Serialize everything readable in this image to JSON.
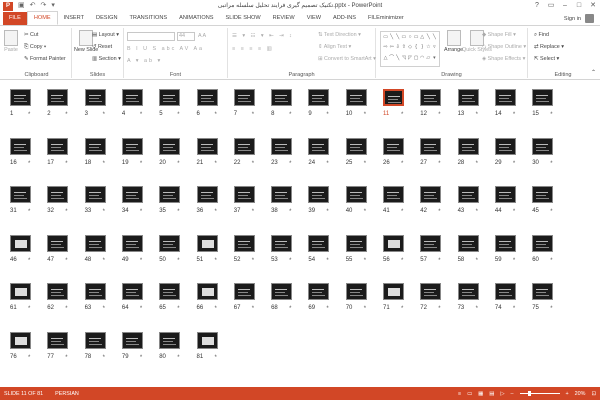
{
  "window": {
    "title": "تکنیک تصمیم گیری فرایند تحلیل سلسله مراتبی.pptx - PowerPoint",
    "app_icon": "P",
    "icons": {
      "save": "save-icon",
      "undo": "undo-icon",
      "redo": "redo-icon",
      "customize": "customize-icon",
      "help": "help-icon",
      "minimize": "minimize-icon",
      "restore": "restore-icon",
      "close": "close-icon"
    }
  },
  "tabs": [
    {
      "label": "FILE"
    },
    {
      "label": "HOME"
    },
    {
      "label": "INSERT"
    },
    {
      "label": "DESIGN"
    },
    {
      "label": "TRANSITIONS"
    },
    {
      "label": "ANIMATIONS"
    },
    {
      "label": "SLIDE SHOW"
    },
    {
      "label": "REVIEW"
    },
    {
      "label": "VIEW"
    },
    {
      "label": "ADD-INS"
    },
    {
      "label": "FILEminimizer"
    }
  ],
  "account": {
    "signin": "Sign in"
  },
  "ribbon": {
    "clipboard": {
      "paste": "Paste",
      "cut": "Cut",
      "copy": "Copy",
      "format_painter": "Format Painter",
      "label": "Clipboard"
    },
    "slides": {
      "new_slide": "New Slide",
      "layout": "Layout",
      "reset": "Reset",
      "section": "Section",
      "label": "Slides"
    },
    "font": {
      "size": "44",
      "label": "Font"
    },
    "paragraph": {
      "text_direction": "Text Direction",
      "align_text": "Align Text",
      "convert": "Convert to SmartArt",
      "label": "Paragraph"
    },
    "drawing": {
      "arrange": "Arrange",
      "quick_styles": "Quick Styles",
      "shape_fill": "Shape Fill",
      "shape_outline": "Shape Outline",
      "shape_effects": "Shape Effects",
      "label": "Drawing"
    },
    "editing": {
      "find": "Find",
      "replace": "Replace",
      "select": "Select",
      "label": "Editing"
    }
  },
  "slides": [
    "1",
    "2",
    "3",
    "4",
    "5",
    "6",
    "7",
    "8",
    "9",
    "10",
    "11",
    "12",
    "13",
    "14",
    "15",
    "16",
    "17",
    "18",
    "19",
    "20",
    "21",
    "22",
    "23",
    "24",
    "25",
    "26",
    "27",
    "28",
    "29",
    "30",
    "31",
    "32",
    "33",
    "34",
    "35",
    "36",
    "37",
    "38",
    "39",
    "40",
    "41",
    "42",
    "43",
    "44",
    "45",
    "46",
    "47",
    "48",
    "49",
    "50",
    "51",
    "52",
    "53",
    "54",
    "55",
    "56",
    "57",
    "58",
    "59",
    "60",
    "61",
    "62",
    "63",
    "64",
    "65",
    "66",
    "67",
    "68",
    "69",
    "70",
    "71",
    "72",
    "73",
    "74",
    "75",
    "76",
    "77",
    "78",
    "79",
    "80",
    "81"
  ],
  "selected_slide": "11",
  "star": "*",
  "status": {
    "slide": "SLIDE 11 OF 81",
    "language": "PERSIAN",
    "zoom": "20%"
  },
  "colors": {
    "accent": "#d24726",
    "thumb_bg": "#1b1b1b"
  }
}
